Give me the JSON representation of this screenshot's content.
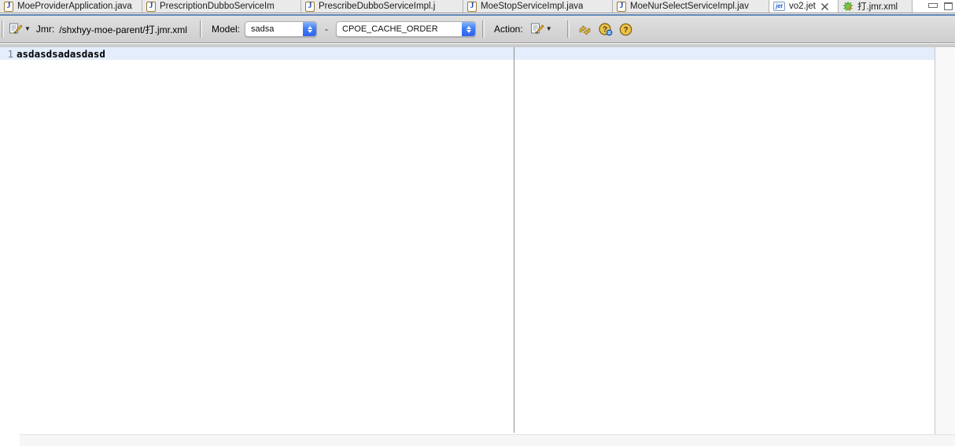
{
  "tab_bar": {
    "tabs": [
      {
        "label": "MoeProviderApplication.java",
        "icon": "java-file-icon",
        "active": false
      },
      {
        "label": "PrescriptionDubboServiceIm",
        "icon": "java-file-icon",
        "active": false
      },
      {
        "label": "PrescribeDubboServiceImpl.j",
        "icon": "java-file-icon",
        "active": false
      },
      {
        "label": "MoeStopServiceImpl.java",
        "icon": "java-file-icon",
        "active": false
      },
      {
        "label": "MoeNurSelectServiceImpl.jav",
        "icon": "java-file-icon",
        "active": false
      },
      {
        "label": "vo2.jet",
        "icon": "jet-file-icon",
        "active": true,
        "closable": true
      },
      {
        "label": "打.jmr.xml",
        "icon": "jmr-leaf-icon",
        "active": false
      }
    ]
  },
  "toolbar": {
    "jmr_label": "Jmr:",
    "jmr_path": "/shxhyy-moe-parent/打.jmr.xml",
    "model_label": "Model:",
    "model_select_value": "sadsa",
    "separator_dash": "-",
    "table_select_value": "CPOE_CACHE_ORDER",
    "action_label": "Action:"
  },
  "editor": {
    "lines": [
      {
        "number": "1",
        "text": "asdasdsadasdasd"
      }
    ]
  },
  "icons": {
    "java_glyph": "J",
    "jet_icon_text": "jet"
  },
  "colors": {
    "tab_underline": "#5e84b6",
    "inactive_tab_bg": "#eaeaea",
    "active_tab_bg": "#ffffff",
    "toolbar_bg": "#d6d6d6",
    "current_line_highlight": "#e3edfb",
    "select_cap_blue": "#2c63ee",
    "coin_gold": "#e3b733",
    "sync_arrow_gold": "#d9a928"
  }
}
